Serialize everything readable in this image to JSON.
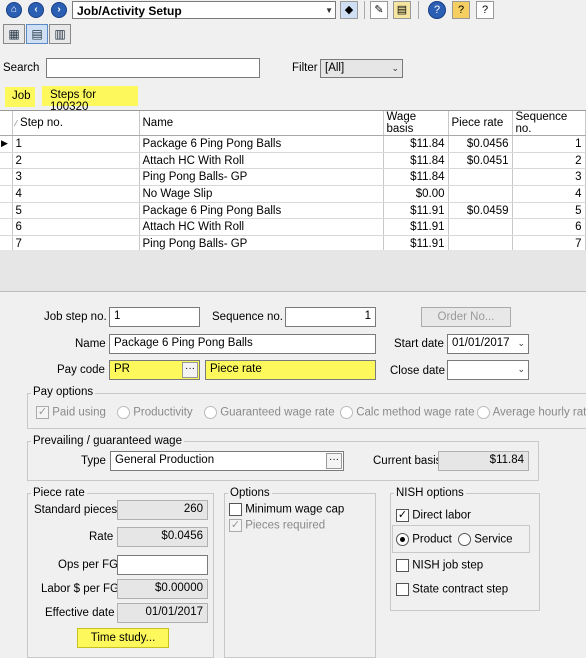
{
  "toolbar": {
    "title": "Job/Activity Setup",
    "nav_icons": [
      "home-icon",
      "back-icon",
      "forward-icon"
    ],
    "action_icons": [
      "tag-icon",
      "report-icon",
      "folder-icon",
      "help-icon",
      "open-folder-icon",
      "info-icon"
    ]
  },
  "search": {
    "label": "Search",
    "value": ""
  },
  "filter": {
    "label": "Filter",
    "value": "[All]"
  },
  "breadcrumb": {
    "job": "Job",
    "steps": "Steps for 100320"
  },
  "grid": {
    "headers": {
      "step": "Step no.",
      "name": "Name",
      "wage": "Wage basis",
      "piece": "Piece rate",
      "seq": "Sequence no."
    },
    "rows": [
      {
        "step": "1",
        "name": "Package 6 Ping Pong Balls",
        "wage": "$11.84",
        "piece": "$0.0456",
        "seq": "1"
      },
      {
        "step": "2",
        "name": "Attach HC With Roll",
        "wage": "$11.84",
        "piece": "$0.0451",
        "seq": "2"
      },
      {
        "step": "3",
        "name": "Ping Pong Balls- GP",
        "wage": "$11.84",
        "piece": "",
        "seq": "3"
      },
      {
        "step": "4",
        "name": "No Wage Slip",
        "wage": "$0.00",
        "piece": "",
        "seq": "4"
      },
      {
        "step": "5",
        "name": "Package 6 Ping Pong Balls",
        "wage": "$11.91",
        "piece": "$0.0459",
        "seq": "5"
      },
      {
        "step": "6",
        "name": "Attach HC With Roll",
        "wage": "$11.91",
        "piece": "",
        "seq": "6"
      },
      {
        "step": "7",
        "name": "Ping Pong Balls- GP",
        "wage": "$11.91",
        "piece": "",
        "seq": "7"
      }
    ]
  },
  "form": {
    "job_step_label": "Job step no.",
    "job_step_value": "1",
    "sequence_label": "Sequence no.",
    "sequence_value": "1",
    "order_button": "Order No...",
    "name_label": "Name",
    "name_value": "Package 6 Ping Pong Balls",
    "start_date_label": "Start date",
    "start_date_value": "01/01/2017",
    "pay_code_label": "Pay code",
    "pay_code_value": "PR",
    "pay_code_desc": "Piece rate",
    "close_date_label": "Close date",
    "close_date_value": ""
  },
  "pay_options": {
    "title": "Pay options",
    "paid_using": "Paid using",
    "options": [
      "Productivity",
      "Guaranteed wage rate",
      "Calc method wage rate",
      "Average hourly rate"
    ]
  },
  "prevailing": {
    "title": "Prevailing / guaranteed wage",
    "type_label": "Type",
    "type_value": "General Production",
    "current_basis_label": "Current basis",
    "current_basis_value": "$11.84"
  },
  "piece_rate": {
    "title": "Piece rate",
    "standard_label": "Standard pieces",
    "standard_value": "260",
    "rate_label": "Rate",
    "rate_value": "$0.0456",
    "ops_label": "Ops per FG",
    "ops_value": "",
    "labor_label": "Labor $ per FG",
    "labor_value": "$0.00000",
    "effective_label": "Effective date",
    "effective_value": "01/01/2017",
    "time_study": "Time study..."
  },
  "options": {
    "title": "Options",
    "min_wage": "Minimum wage cap",
    "pieces_required": "Pieces required"
  },
  "nish": {
    "title": "NISH options",
    "direct_labor": "Direct labor",
    "product": "Product",
    "service": "Service",
    "job_step": "NISH job step",
    "state_contract": "State contract step"
  },
  "colors": {
    "highlight": "#fdf95d",
    "nav_blue": "#2b5fb4"
  }
}
